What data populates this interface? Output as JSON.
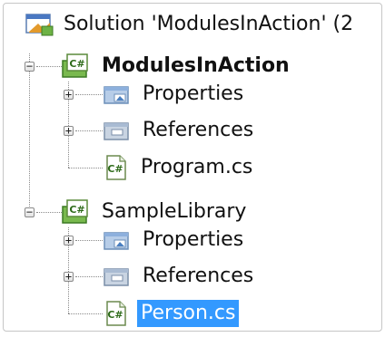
{
  "tree": {
    "solution": {
      "label": "Solution 'ModulesInAction' (2",
      "icon": "solution-icon"
    },
    "projects": [
      {
        "label": "ModulesInAction",
        "bold": true,
        "icon": "csharp-project-icon",
        "expander": "−",
        "children": [
          {
            "label": "Properties",
            "icon": "properties-folder-icon",
            "expander": "+"
          },
          {
            "label": "References",
            "icon": "references-folder-icon",
            "expander": "+"
          },
          {
            "label": "Program.cs",
            "icon": "csharp-file-icon"
          }
        ]
      },
      {
        "label": "SampleLibrary",
        "bold": false,
        "icon": "csharp-project-icon",
        "expander": "−",
        "children": [
          {
            "label": "Properties",
            "icon": "properties-folder-icon",
            "expander": "+"
          },
          {
            "label": "References",
            "icon": "references-folder-icon",
            "expander": "+"
          },
          {
            "label": "Person.cs",
            "icon": "csharp-file-icon",
            "selected": true
          }
        ]
      }
    ]
  },
  "colors": {
    "selection": "#3399ff",
    "text": "#111111",
    "lines": "#8a8a8a"
  }
}
